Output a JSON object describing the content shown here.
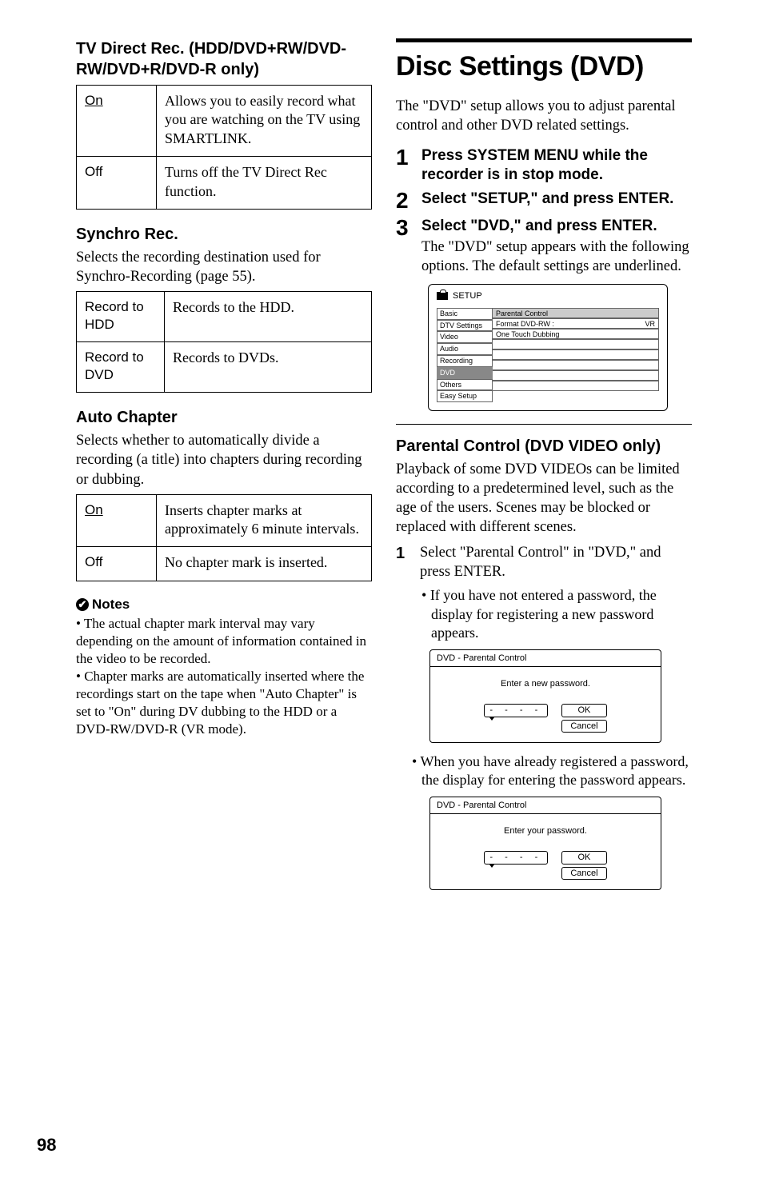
{
  "left": {
    "tv_direct_rec_heading": "TV Direct Rec. (HDD/DVD+RW/DVD-RW/DVD+R/DVD-R only)",
    "tv_direct_rec_rows": [
      {
        "k": "On",
        "v": "Allows you to easily record what you are watching on the TV using SMARTLINK.",
        "default": true
      },
      {
        "k": "Off",
        "v": "Turns off the TV Direct Rec function.",
        "default": false
      }
    ],
    "synchro_heading": "Synchro Rec.",
    "synchro_body": "Selects the recording destination used for Synchro-Recording (page 55).",
    "synchro_rows": [
      {
        "k": "Record to HDD",
        "v": "Records to the HDD."
      },
      {
        "k": "Record to DVD",
        "v": "Records to DVDs."
      }
    ],
    "autochap_heading": "Auto Chapter",
    "autochap_body": "Selects whether to automatically divide a recording (a title) into chapters during recording or dubbing.",
    "autochap_rows": [
      {
        "k": "On",
        "v": "Inserts chapter marks at approximately 6 minute intervals.",
        "default": true
      },
      {
        "k": "Off",
        "v": "No chapter mark is inserted.",
        "default": false
      }
    ],
    "notes_label": "Notes",
    "notes": [
      "The actual chapter mark interval may vary depending on the amount of information contained in the video to be recorded.",
      "Chapter marks are automatically inserted where the recordings start on the tape when \"Auto Chapter\" is set to \"On\" during DV dubbing to the HDD or a DVD-RW/DVD-R (VR mode)."
    ]
  },
  "right": {
    "title": "Disc Settings (DVD)",
    "lead": "The \"DVD\" setup allows you to adjust parental control and other DVD related settings.",
    "steps": [
      {
        "n": "1",
        "bold": "Press SYSTEM MENU while the recorder is in stop mode."
      },
      {
        "n": "2",
        "bold": "Select \"SETUP,\" and press ENTER."
      },
      {
        "n": "3",
        "bold": "Select \"DVD,\" and press ENTER.",
        "body": "The \"DVD\" setup appears with the following options. The default settings are underlined."
      }
    ],
    "osd": {
      "title": "SETUP",
      "tabs": [
        "Basic",
        "DTV Settings",
        "Video",
        "Audio",
        "Recording",
        "DVD",
        "Others",
        "Easy Setup"
      ],
      "selected_tab": "DVD",
      "items": [
        {
          "label": "Parental Control",
          "value": ""
        },
        {
          "label": "Format DVD-RW :",
          "value": "VR"
        },
        {
          "label": "One Touch Dubbing",
          "value": ""
        }
      ]
    },
    "parental_heading": "Parental Control (DVD VIDEO only)",
    "parental_body": "Playback of some DVD VIDEOs can be limited according to a predetermined level, such as the age of the users. Scenes may be blocked or replaced with different scenes.",
    "substep_n": "1",
    "substep_body": "Select \"Parental Control\" in \"DVD,\" and press ENTER.",
    "sub_bullets": [
      "If you have not entered a password, the display for registering a new password appears."
    ],
    "dialog1": {
      "title": "DVD - Parental Control",
      "msg": "Enter a new password.",
      "field": "- - - -",
      "ok": "OK",
      "cancel": "Cancel"
    },
    "bullet2": "When you have already registered a password, the display for entering the password appears.",
    "dialog2": {
      "title": "DVD - Parental Control",
      "msg": "Enter your password.",
      "field": "- - - -",
      "ok": "OK",
      "cancel": "Cancel"
    }
  },
  "pagenum": "98"
}
